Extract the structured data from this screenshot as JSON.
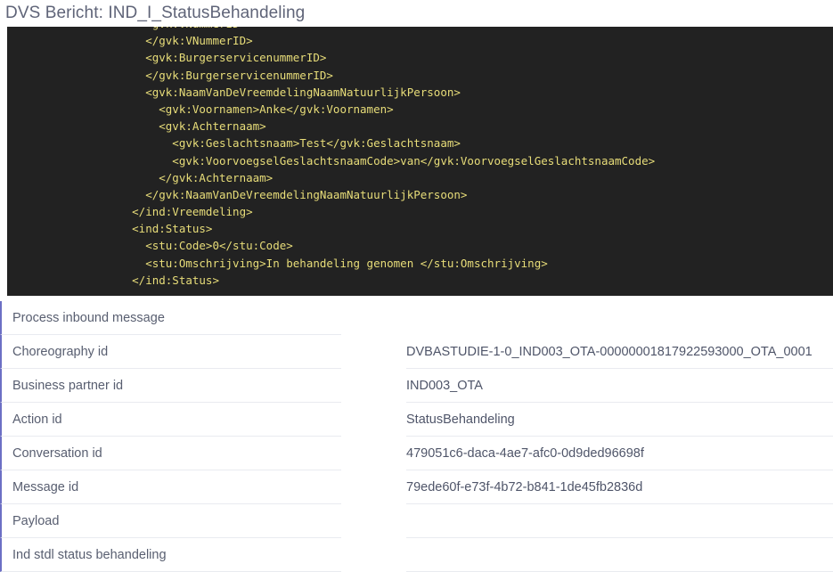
{
  "page": {
    "title": "DVS Bericht: IND_I_StatusBehandeling"
  },
  "code_viewer": {
    "language": "xml",
    "background_color": "#222222",
    "text_color": "#e8dd79",
    "lines": [
      "        <gvk:VNummerID>",
      "        </gvk:VNummerID>",
      "        <gvk:BurgerservicenummerID>",
      "        </gvk:BurgerservicenummerID>",
      "        <gvk:NaamVanDeVreemdelingNaamNatuurlijkPersoon>",
      "          <gvk:Voornamen>Anke</gvk:Voornamen>",
      "          <gvk:Achternaam>",
      "            <gvk:Geslachtsnaam>Test</gvk:Geslachtsnaam>",
      "            <gvk:VoorvoegselGeslachtsnaamCode>van</gvk:VoorvoegselGeslachtsnaamCode>",
      "          </gvk:Achternaam>",
      "        </gvk:NaamVanDeVreemdelingNaamNatuurlijkPersoon>",
      "      </ind:Vreemdeling>",
      "      <ind:Status>",
      "        <stu:Code>0</stu:Code>",
      "        <stu:Omschrijving>In behandeling genomen </stu:Omschrijving>",
      "      </ind:Status>"
    ]
  },
  "properties": {
    "accent_color": "#6c6fc4",
    "rows": [
      {
        "label": "Process inbound message",
        "value": ""
      },
      {
        "label": "Choreography id",
        "value": "DVBASTUDIE-1-0_IND003_OTA-00000001817922593000_OTA_0001"
      },
      {
        "label": "Business partner id",
        "value": "IND003_OTA"
      },
      {
        "label": "Action id",
        "value": "StatusBehandeling"
      },
      {
        "label": "Conversation id",
        "value": "479051c6-daca-4ae7-afc0-0d9ded96698f"
      },
      {
        "label": "Message id",
        "value": "79ede60f-e73f-4b72-b841-1de45fb2836d"
      },
      {
        "label": "Payload",
        "value": ""
      },
      {
        "label": "Ind stdl status behandeling",
        "value": ""
      }
    ]
  }
}
